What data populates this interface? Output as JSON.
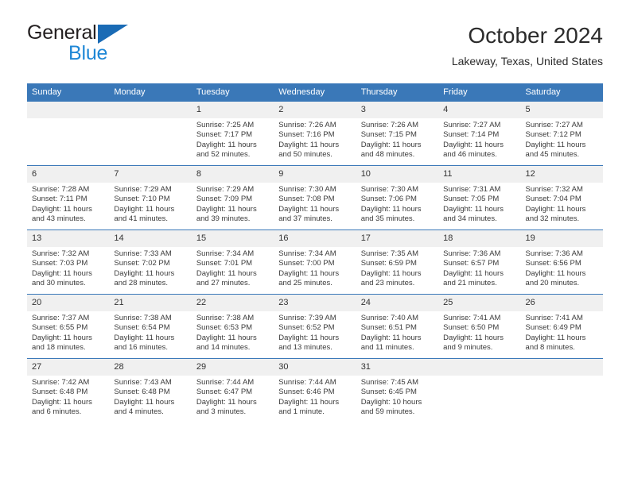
{
  "brand": {
    "line1": "General",
    "line2": "Blue",
    "triangle_color": "#1a6bb5",
    "blue_text_color": "#1e87d6"
  },
  "header": {
    "title": "October 2024",
    "subtitle": "Lakeway, Texas, United States",
    "accent_color": "#3a78b8",
    "daynum_band_color": "#f0f0f0"
  },
  "weekdays": [
    "Sunday",
    "Monday",
    "Tuesday",
    "Wednesday",
    "Thursday",
    "Friday",
    "Saturday"
  ],
  "weeks": [
    [
      {
        "day": "",
        "sunrise": "",
        "sunset": "",
        "daylight_line1": "",
        "daylight_line2": ""
      },
      {
        "day": "",
        "sunrise": "",
        "sunset": "",
        "daylight_line1": "",
        "daylight_line2": ""
      },
      {
        "day": "1",
        "sunrise": "Sunrise: 7:25 AM",
        "sunset": "Sunset: 7:17 PM",
        "daylight_line1": "Daylight: 11 hours",
        "daylight_line2": "and 52 minutes."
      },
      {
        "day": "2",
        "sunrise": "Sunrise: 7:26 AM",
        "sunset": "Sunset: 7:16 PM",
        "daylight_line1": "Daylight: 11 hours",
        "daylight_line2": "and 50 minutes."
      },
      {
        "day": "3",
        "sunrise": "Sunrise: 7:26 AM",
        "sunset": "Sunset: 7:15 PM",
        "daylight_line1": "Daylight: 11 hours",
        "daylight_line2": "and 48 minutes."
      },
      {
        "day": "4",
        "sunrise": "Sunrise: 7:27 AM",
        "sunset": "Sunset: 7:14 PM",
        "daylight_line1": "Daylight: 11 hours",
        "daylight_line2": "and 46 minutes."
      },
      {
        "day": "5",
        "sunrise": "Sunrise: 7:27 AM",
        "sunset": "Sunset: 7:12 PM",
        "daylight_line1": "Daylight: 11 hours",
        "daylight_line2": "and 45 minutes."
      }
    ],
    [
      {
        "day": "6",
        "sunrise": "Sunrise: 7:28 AM",
        "sunset": "Sunset: 7:11 PM",
        "daylight_line1": "Daylight: 11 hours",
        "daylight_line2": "and 43 minutes."
      },
      {
        "day": "7",
        "sunrise": "Sunrise: 7:29 AM",
        "sunset": "Sunset: 7:10 PM",
        "daylight_line1": "Daylight: 11 hours",
        "daylight_line2": "and 41 minutes."
      },
      {
        "day": "8",
        "sunrise": "Sunrise: 7:29 AM",
        "sunset": "Sunset: 7:09 PM",
        "daylight_line1": "Daylight: 11 hours",
        "daylight_line2": "and 39 minutes."
      },
      {
        "day": "9",
        "sunrise": "Sunrise: 7:30 AM",
        "sunset": "Sunset: 7:08 PM",
        "daylight_line1": "Daylight: 11 hours",
        "daylight_line2": "and 37 minutes."
      },
      {
        "day": "10",
        "sunrise": "Sunrise: 7:30 AM",
        "sunset": "Sunset: 7:06 PM",
        "daylight_line1": "Daylight: 11 hours",
        "daylight_line2": "and 35 minutes."
      },
      {
        "day": "11",
        "sunrise": "Sunrise: 7:31 AM",
        "sunset": "Sunset: 7:05 PM",
        "daylight_line1": "Daylight: 11 hours",
        "daylight_line2": "and 34 minutes."
      },
      {
        "day": "12",
        "sunrise": "Sunrise: 7:32 AM",
        "sunset": "Sunset: 7:04 PM",
        "daylight_line1": "Daylight: 11 hours",
        "daylight_line2": "and 32 minutes."
      }
    ],
    [
      {
        "day": "13",
        "sunrise": "Sunrise: 7:32 AM",
        "sunset": "Sunset: 7:03 PM",
        "daylight_line1": "Daylight: 11 hours",
        "daylight_line2": "and 30 minutes."
      },
      {
        "day": "14",
        "sunrise": "Sunrise: 7:33 AM",
        "sunset": "Sunset: 7:02 PM",
        "daylight_line1": "Daylight: 11 hours",
        "daylight_line2": "and 28 minutes."
      },
      {
        "day": "15",
        "sunrise": "Sunrise: 7:34 AM",
        "sunset": "Sunset: 7:01 PM",
        "daylight_line1": "Daylight: 11 hours",
        "daylight_line2": "and 27 minutes."
      },
      {
        "day": "16",
        "sunrise": "Sunrise: 7:34 AM",
        "sunset": "Sunset: 7:00 PM",
        "daylight_line1": "Daylight: 11 hours",
        "daylight_line2": "and 25 minutes."
      },
      {
        "day": "17",
        "sunrise": "Sunrise: 7:35 AM",
        "sunset": "Sunset: 6:59 PM",
        "daylight_line1": "Daylight: 11 hours",
        "daylight_line2": "and 23 minutes."
      },
      {
        "day": "18",
        "sunrise": "Sunrise: 7:36 AM",
        "sunset": "Sunset: 6:57 PM",
        "daylight_line1": "Daylight: 11 hours",
        "daylight_line2": "and 21 minutes."
      },
      {
        "day": "19",
        "sunrise": "Sunrise: 7:36 AM",
        "sunset": "Sunset: 6:56 PM",
        "daylight_line1": "Daylight: 11 hours",
        "daylight_line2": "and 20 minutes."
      }
    ],
    [
      {
        "day": "20",
        "sunrise": "Sunrise: 7:37 AM",
        "sunset": "Sunset: 6:55 PM",
        "daylight_line1": "Daylight: 11 hours",
        "daylight_line2": "and 18 minutes."
      },
      {
        "day": "21",
        "sunrise": "Sunrise: 7:38 AM",
        "sunset": "Sunset: 6:54 PM",
        "daylight_line1": "Daylight: 11 hours",
        "daylight_line2": "and 16 minutes."
      },
      {
        "day": "22",
        "sunrise": "Sunrise: 7:38 AM",
        "sunset": "Sunset: 6:53 PM",
        "daylight_line1": "Daylight: 11 hours",
        "daylight_line2": "and 14 minutes."
      },
      {
        "day": "23",
        "sunrise": "Sunrise: 7:39 AM",
        "sunset": "Sunset: 6:52 PM",
        "daylight_line1": "Daylight: 11 hours",
        "daylight_line2": "and 13 minutes."
      },
      {
        "day": "24",
        "sunrise": "Sunrise: 7:40 AM",
        "sunset": "Sunset: 6:51 PM",
        "daylight_line1": "Daylight: 11 hours",
        "daylight_line2": "and 11 minutes."
      },
      {
        "day": "25",
        "sunrise": "Sunrise: 7:41 AM",
        "sunset": "Sunset: 6:50 PM",
        "daylight_line1": "Daylight: 11 hours",
        "daylight_line2": "and 9 minutes."
      },
      {
        "day": "26",
        "sunrise": "Sunrise: 7:41 AM",
        "sunset": "Sunset: 6:49 PM",
        "daylight_line1": "Daylight: 11 hours",
        "daylight_line2": "and 8 minutes."
      }
    ],
    [
      {
        "day": "27",
        "sunrise": "Sunrise: 7:42 AM",
        "sunset": "Sunset: 6:48 PM",
        "daylight_line1": "Daylight: 11 hours",
        "daylight_line2": "and 6 minutes."
      },
      {
        "day": "28",
        "sunrise": "Sunrise: 7:43 AM",
        "sunset": "Sunset: 6:48 PM",
        "daylight_line1": "Daylight: 11 hours",
        "daylight_line2": "and 4 minutes."
      },
      {
        "day": "29",
        "sunrise": "Sunrise: 7:44 AM",
        "sunset": "Sunset: 6:47 PM",
        "daylight_line1": "Daylight: 11 hours",
        "daylight_line2": "and 3 minutes."
      },
      {
        "day": "30",
        "sunrise": "Sunrise: 7:44 AM",
        "sunset": "Sunset: 6:46 PM",
        "daylight_line1": "Daylight: 11 hours",
        "daylight_line2": "and 1 minute."
      },
      {
        "day": "31",
        "sunrise": "Sunrise: 7:45 AM",
        "sunset": "Sunset: 6:45 PM",
        "daylight_line1": "Daylight: 10 hours",
        "daylight_line2": "and 59 minutes."
      },
      {
        "day": "",
        "sunrise": "",
        "sunset": "",
        "daylight_line1": "",
        "daylight_line2": ""
      },
      {
        "day": "",
        "sunrise": "",
        "sunset": "",
        "daylight_line1": "",
        "daylight_line2": ""
      }
    ]
  ]
}
